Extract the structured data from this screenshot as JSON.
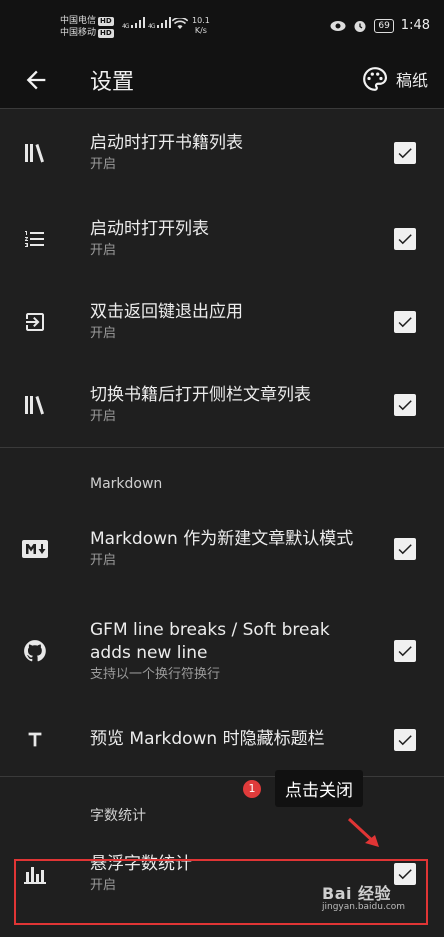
{
  "status_bar": {
    "carrier1": "中国电信",
    "carrier2": "中国移动",
    "hd": "HD",
    "net": "4G",
    "speed_value": "10.1",
    "speed_unit": "K/s",
    "battery": "69",
    "time": "1:48"
  },
  "appbar": {
    "title": "设置",
    "theme_label": "稿纸",
    "back_icon": "arrow-left",
    "theme_icon": "palette"
  },
  "group1": [
    {
      "icon": "library-books",
      "title": "启动时打开书籍列表",
      "subtitle": "开启",
      "checked": true
    },
    {
      "icon": "format-list-numbered",
      "title": "启动时打开列表",
      "subtitle": "开启",
      "checked": true
    },
    {
      "icon": "exit-to-app",
      "title": "双击返回键退出应用",
      "subtitle": "开启",
      "checked": true
    },
    {
      "icon": "library-books",
      "title": "切换书籍后打开侧栏文章列表",
      "subtitle": "开启",
      "checked": true
    }
  ],
  "section_markdown": "Markdown",
  "markdown_items": [
    {
      "icon": "markdown",
      "title": "Markdown 作为新建文章默认模式",
      "subtitle": "开启",
      "checked": true
    },
    {
      "icon": "github",
      "title": "GFM line breaks / Soft break adds new line",
      "subtitle": "支持以一个换行符换行",
      "checked": true
    },
    {
      "icon": "format-title",
      "title": "预览 Markdown 时隐藏标题栏",
      "subtitle": "",
      "checked": true
    }
  ],
  "section_wordcount": "字数统计",
  "wordcount_items": [
    {
      "icon": "bar-chart",
      "title": "悬浮字数统计",
      "subtitle": "开启",
      "checked": true
    }
  ],
  "annotation": {
    "step": "1",
    "text": "点击关闭"
  },
  "watermark": {
    "main": "Bai 经验",
    "sub": "jingyan.baidu.com"
  }
}
